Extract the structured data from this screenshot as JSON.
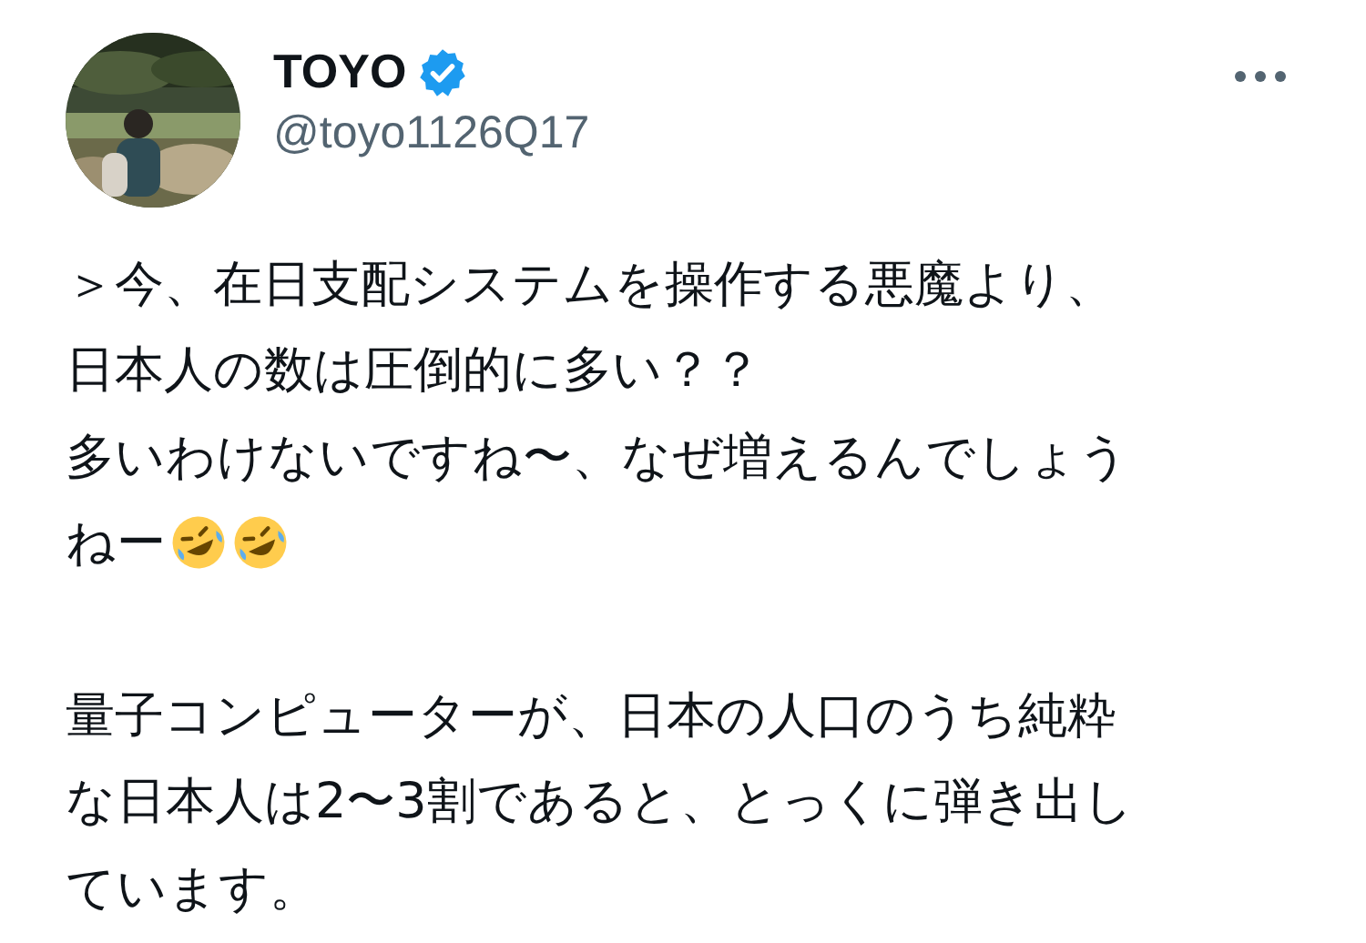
{
  "author": {
    "name": "TOYO",
    "verified": true,
    "handle": "@toyo1126Q17"
  },
  "paragraphs": [
    {
      "lines": [
        {
          "text": "＞今、在日支配システムを操作する悪魔より、"
        },
        {
          "text": "日本人の数は圧倒的に多い？？"
        },
        {
          "text": "多いわけないですね〜、なぜ増えるんでしょう"
        },
        {
          "text": "ねー",
          "emojis": [
            {
              "kind": "rofl"
            },
            {
              "kind": "rofl"
            }
          ]
        }
      ]
    },
    {
      "lines": [
        {
          "text": "量子コンピューターが、日本の人口のうち純粋"
        },
        {
          "text": "な日本人は2〜3割であると、とっくに弾き出し"
        },
        {
          "text": "ています。"
        }
      ]
    }
  ]
}
